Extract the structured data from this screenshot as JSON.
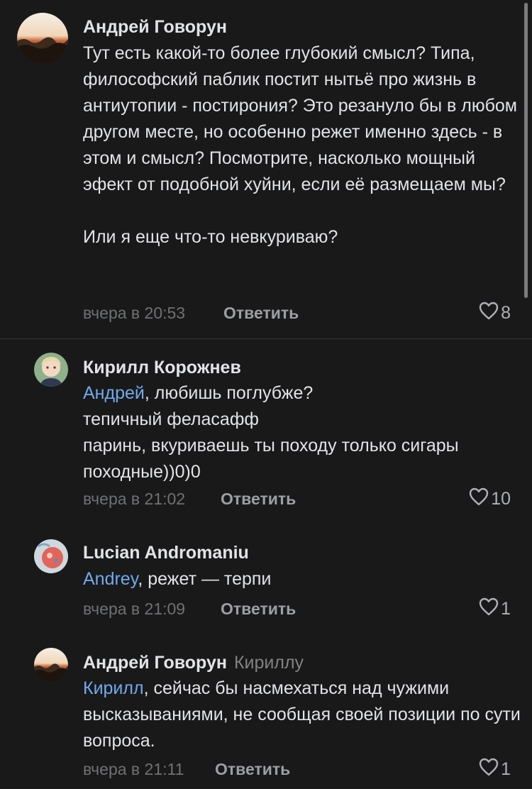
{
  "comments": [
    {
      "author": "Андрей Говорун",
      "text": "Тут есть какой-то более глубокий смысл? Типа, философский паблик постит нытьё про жизнь в антиутопии - постирония? Это резануло бы в любом другом месте, но особенно режет именно здесь - в этом и смысл? Посмотрите, насколько мощный эфект от подобной хуйни, если её размещаем мы?\n\nИли я еще что-то невкуриваю?",
      "time": "вчера в 20:53",
      "reply_label": "Ответить",
      "likes": "8"
    },
    {
      "author": "Кирилл Корожнев",
      "mention": "Андрей",
      "text": ", любишь поглубже?\nтепичный феласафф\nпаринь, вкуриваешь ты походу только сигары походные))0)0",
      "time": "вчера в 21:02",
      "reply_label": "Ответить",
      "likes": "10"
    },
    {
      "author": "Lucian Andromaniu",
      "mention": "Andrey",
      "text": ", режет — терпи",
      "time": "вчера в 21:09",
      "reply_label": "Ответить",
      "likes": "1"
    },
    {
      "author": "Андрей Говорун",
      "reply_to": "Кириллу",
      "mention": "Кирилл",
      "text": ", сейчас бы насмехаться над чужими высказываниями, не сообщая своей позиции по сути вопроса.",
      "time": "вчера в 21:11",
      "reply_label": "Ответить",
      "likes": "1"
    }
  ],
  "colors": {
    "background": "#19191a",
    "mention": "#71aaeb",
    "meta": "#6f7173"
  }
}
